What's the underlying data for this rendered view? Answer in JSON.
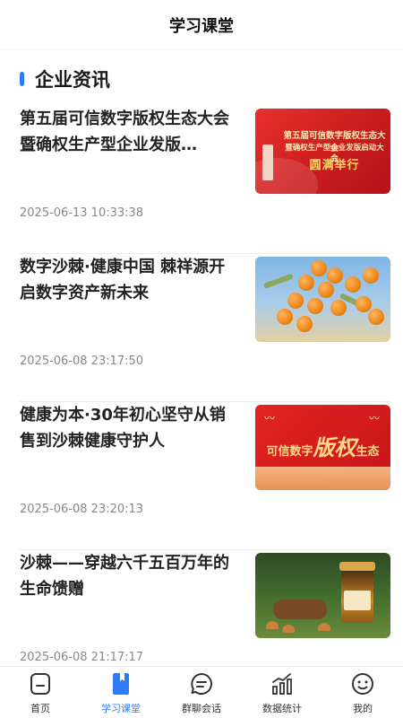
{
  "header": {
    "title": "学习课堂"
  },
  "section": {
    "title": "企业资讯"
  },
  "articles": [
    {
      "title": "第五届可信数字版权生态大会暨确权生产型企业发版…",
      "date": "2025-06-13 10:33:38",
      "thumb_lines": [
        "第五届可信数字版权生态大会",
        "暨确权生产型企业发版启动大会",
        "圆满举行"
      ]
    },
    {
      "title": "数字沙棘·健康中国 棘祥源开启数字资产新未来",
      "date": "2025-06-08 23:17:50"
    },
    {
      "title": "健康为本·30年初心坚守从销售到沙棘健康守护人",
      "date": "2025-06-08 23:20:13",
      "thumb_lines": [
        "可信数字",
        "版权",
        "生态"
      ]
    },
    {
      "title": "沙棘——穿越六千五百万年的生命馈赠",
      "date": "2025-06-08 21:17:17"
    }
  ],
  "tabs": [
    {
      "label": "首页",
      "icon": "home-icon"
    },
    {
      "label": "学习课堂",
      "icon": "book-icon",
      "active": true
    },
    {
      "label": "群聊会话",
      "icon": "chat-icon"
    },
    {
      "label": "数据统计",
      "icon": "stats-icon"
    },
    {
      "label": "我的",
      "icon": "profile-icon"
    }
  ],
  "colors": {
    "accent": "#2f7bf6",
    "text": "#222222",
    "muted": "#888888"
  }
}
